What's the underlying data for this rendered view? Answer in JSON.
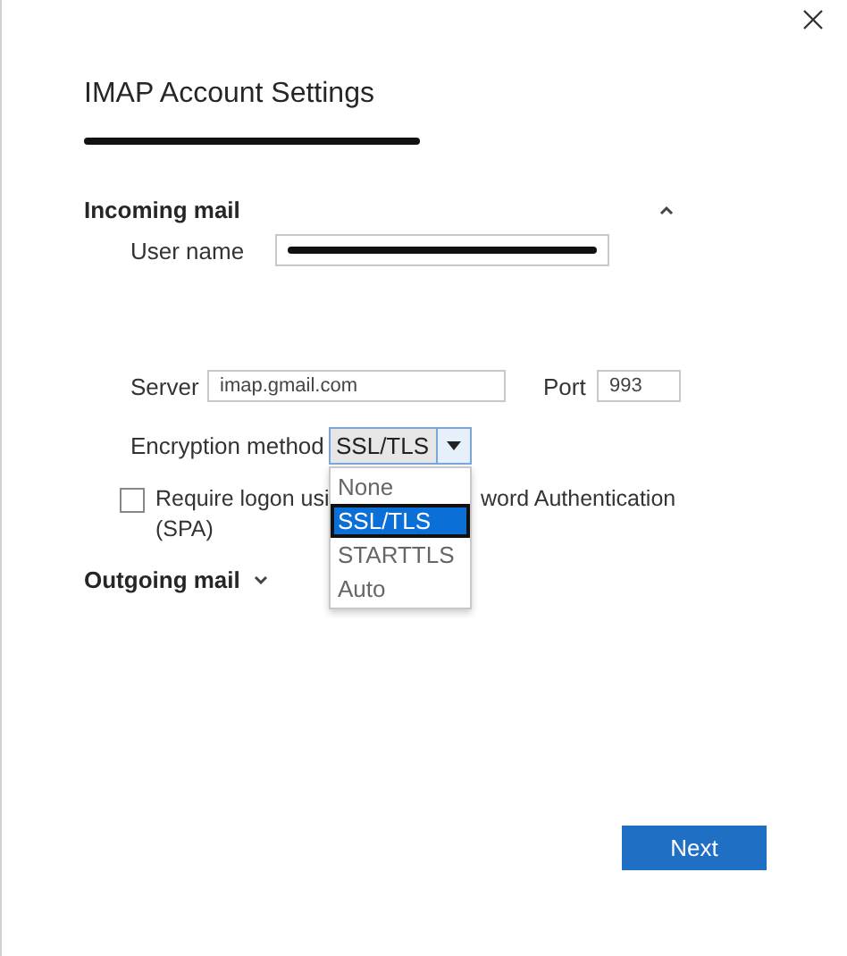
{
  "dialog": {
    "title": "IMAP Account Settings",
    "account_redacted": true
  },
  "incoming": {
    "heading": "Incoming mail",
    "expanded": true,
    "user_name": {
      "label": "User name",
      "redacted": true
    },
    "server": {
      "label": "Server",
      "value": "imap.gmail.com"
    },
    "port": {
      "label": "Port",
      "value": "993"
    },
    "encryption": {
      "label": "Encryption method",
      "value": "SSL/TLS",
      "open": true,
      "options": [
        {
          "label": "None",
          "selected": false
        },
        {
          "label": "SSL/TLS",
          "selected": true
        },
        {
          "label": "STARTTLS",
          "selected": false
        },
        {
          "label": "Auto",
          "selected": false
        }
      ]
    },
    "spa": {
      "checked": false,
      "label_parts": [
        "Require logon usi",
        "word Authentication",
        "(SPA)"
      ]
    }
  },
  "outgoing": {
    "heading": "Outgoing mail",
    "expanded": false
  },
  "buttons": [
    {
      "label": "Next"
    }
  ]
}
